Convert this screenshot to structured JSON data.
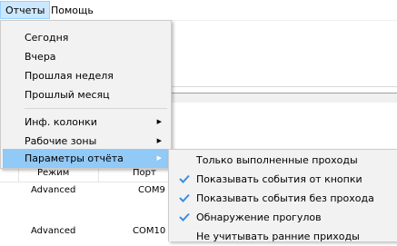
{
  "menubar": {
    "items": [
      {
        "label": "Отчеты",
        "active": true
      },
      {
        "label": "Помощь",
        "active": false
      }
    ]
  },
  "dropdown": {
    "items": [
      {
        "label": "Сегодня"
      },
      {
        "label": "Вчера"
      },
      {
        "label": "Прошлая неделя"
      },
      {
        "label": "Прошлый месяц"
      },
      {
        "label": "Инф. колонки",
        "submenu": true
      },
      {
        "label": "Рабочие зоны",
        "submenu": true
      },
      {
        "label": "Параметры отчёта",
        "submenu": true,
        "highlighted": true
      }
    ]
  },
  "submenu": {
    "items": [
      {
        "label": "Только выполненные проходы",
        "checked": false
      },
      {
        "label": "Показывать события от кнопки",
        "checked": true
      },
      {
        "label": "Показывать события без прохода",
        "checked": true
      },
      {
        "label": "Обнаружение прогулов",
        "checked": true
      },
      {
        "label": "Не учитывать ранние приходы",
        "checked": false
      }
    ]
  },
  "table": {
    "headers": [
      "Режим",
      "Порт"
    ],
    "rows": [
      [
        "Advanced",
        "COM9"
      ],
      [
        "Advanced",
        "COM10"
      ]
    ]
  },
  "colors": {
    "menubar_active_bg": "#cce8ff",
    "menu_highlight_bg": "#91c9f7",
    "check_color": "#3a8ee6",
    "menu_bg": "#f2f2f2"
  },
  "icons": {
    "submenu_arrow": "right-triangle",
    "check": "checkmark"
  }
}
